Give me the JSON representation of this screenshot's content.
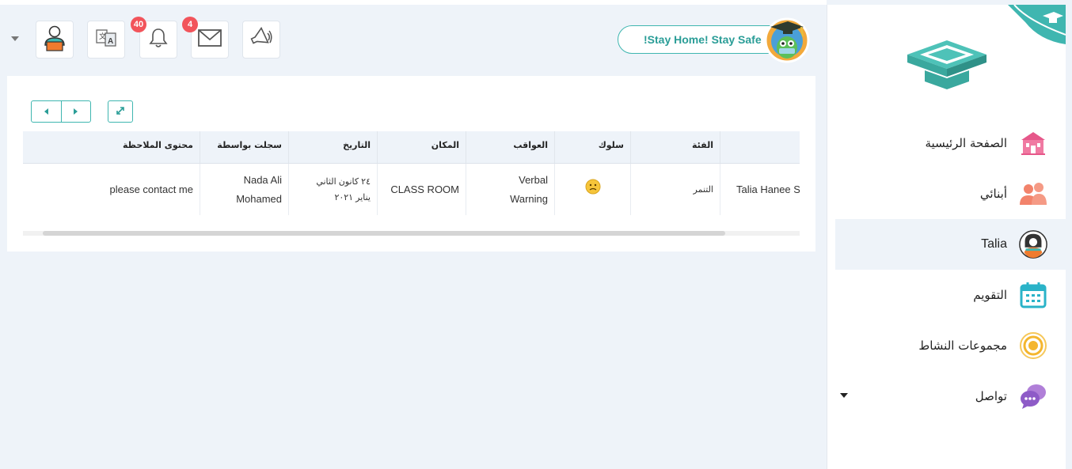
{
  "header": {
    "stay_home_label": "!Stay Home! Stay Safe",
    "notifications_count": "40",
    "messages_count": "4",
    "icons": [
      "megaphone-icon",
      "mail-icon",
      "bell-icon",
      "translate-icon",
      "user-profile-icon",
      "caret-down-icon"
    ]
  },
  "table": {
    "columns": [
      "",
      "الفئة",
      "سلوك",
      "العواقب",
      "المكان",
      "التاريخ",
      "سجلت بواسطة",
      "محتوى الملاحظة"
    ],
    "row": {
      "student": "Talia Hanee S",
      "category": "التنمر",
      "behavior_icon": "sad-face-icon",
      "consequence": "Verbal Warning",
      "place": "CLASS ROOM",
      "date_line1": "٢٤ كانون الثاني",
      "date_line2": "يناير ٢٠٢١",
      "recorded_by": "Nada Ali Mohamed",
      "note": "please contact me"
    }
  },
  "sidebar": {
    "items": [
      {
        "label": "الصفحة الرئيسية",
        "icon": "school-building-icon"
      },
      {
        "label": "أبنائي",
        "icon": "children-icon"
      },
      {
        "label": "Talia",
        "icon": "student-avatar-icon"
      },
      {
        "label": "التقويم",
        "icon": "calendar-icon"
      },
      {
        "label": "مجموعات النشاط",
        "icon": "activity-target-icon"
      },
      {
        "label": "تواصل",
        "icon": "chat-bubbles-icon"
      }
    ]
  },
  "colors": {
    "accent": "#3fb6b0",
    "badge": "#f2545b",
    "background": "#eef3f9"
  }
}
